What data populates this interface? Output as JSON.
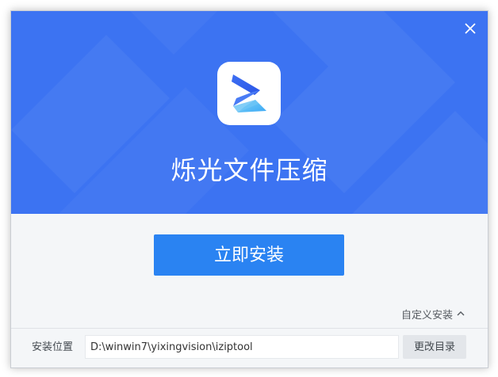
{
  "app": {
    "name": "烁光文件压缩",
    "logo_icon": "lightning-z-logo-icon"
  },
  "colors": {
    "header_bg": "#3c73f2",
    "primary_button": "#2a83f2",
    "body_bg": "#f4f6f8",
    "secondary_button": "#e3e6ea"
  },
  "actions": {
    "install_label": "立即安装",
    "custom_install_label": "自定义安装",
    "custom_install_icon": "chevron-up-icon",
    "close_icon": "close-icon"
  },
  "install_location": {
    "label": "安装位置",
    "path": "D:\\winwin7\\yixingvision\\iziptool",
    "change_button_label": "更改目录"
  }
}
